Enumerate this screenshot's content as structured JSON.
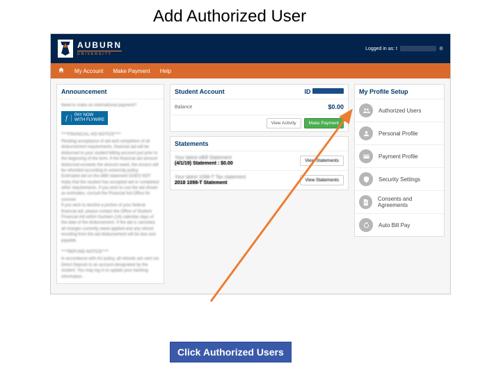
{
  "slide": {
    "title": "Add Authorized User"
  },
  "header": {
    "brand_name": "AUBURN",
    "brand_sub": "UNIVERSITY",
    "logged_in_label": "Logged in as: t"
  },
  "nav": {
    "items": [
      "My Account",
      "Make Payment",
      "Help"
    ]
  },
  "announcement": {
    "title": "Announcement",
    "intro": "Need to make an international payment?",
    "intl_btn": "PAY NOW\nWITH FLYWIRE",
    "notice_head": "****FINANCIAL AID NOTICE****",
    "notice_body": "Pending acceptance of aid and completion of all disbursement requirements, financial aid will be disbursed to your student billing account just prior to the beginning of the term. If the financial aid amount disbursed exceeds the amount owed, the excess will be refunded according to university policy.\nEstimated aid on the eBill statement DOES NOT imply that the student has accepted aid or completed other requirements. If you wish to use the aid shown as estimates, consult the Financial Aid Office for counsel.\nIf you wish to decline a portion of your federal financial aid, please contact the Office of Student Financial Aid within fourteen (14) calendar days of the date of the disbursement. If the aid is canceled, all charges currently owed applied and any refund resulting from the aid disbursement will be due and payable.",
    "refund_head": "****REFUND NOTICE****",
    "refund_body": "In accordance with AU policy, all refunds are sent via Direct Deposit to an account designated by the student. You may log in to update your banking information."
  },
  "student_account": {
    "title": "Student Account",
    "id_label": "ID",
    "balance_label": "Balance",
    "balance_value": "$0.00",
    "view_activity": "View Activity",
    "make_payment": "Make Payment"
  },
  "statements": {
    "title": "Statements",
    "items": [
      {
        "line1": "Your latest eBill Statement",
        "line2": "(4/1/19) Statement : $0.00",
        "btn": "View Statements"
      },
      {
        "line1": "Your latest 1098-T Tax statement",
        "line2": "2018 1098-T Statement",
        "btn": "View Statements"
      }
    ]
  },
  "profile": {
    "title": "My Profile Setup",
    "items": [
      {
        "label": "Authorized Users",
        "icon": "users"
      },
      {
        "label": "Personal Profile",
        "icon": "person"
      },
      {
        "label": "Payment Profile",
        "icon": "card"
      },
      {
        "label": "Security Settings",
        "icon": "shield"
      },
      {
        "label": "Consents and Agreements",
        "icon": "doc"
      },
      {
        "label": "Auto Bill Pay",
        "icon": "refresh"
      }
    ]
  },
  "callout": {
    "text": "Click Authorized Users"
  }
}
